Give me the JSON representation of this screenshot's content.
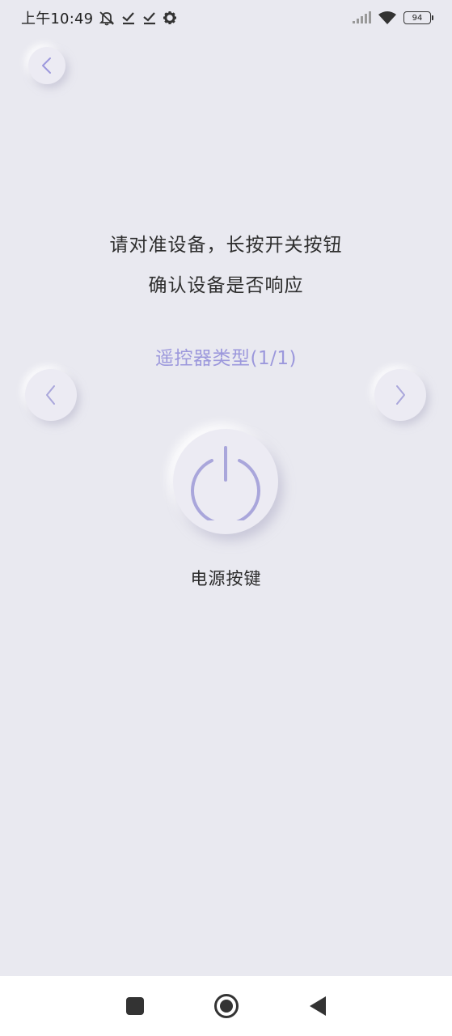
{
  "status_bar": {
    "time": "上午10:49",
    "battery": "94",
    "icons": [
      "mute-icon",
      "check-icon",
      "check-icon",
      "gear-icon",
      "signal-icon",
      "wifi-icon",
      "battery-icon"
    ]
  },
  "instruction": {
    "line1": "请对准设备，长按开关按钮",
    "line2": "确认设备是否响应"
  },
  "remote_type_label": "遥控器类型(1/1)",
  "power": {
    "label": "电源按键"
  },
  "colors": {
    "background": "#E9E9F0",
    "accent": "#9C98DC",
    "power_icon": "#A9A6DB"
  },
  "nav_bar": {
    "icons": [
      "recent-apps-icon",
      "home-icon",
      "back-icon"
    ]
  }
}
